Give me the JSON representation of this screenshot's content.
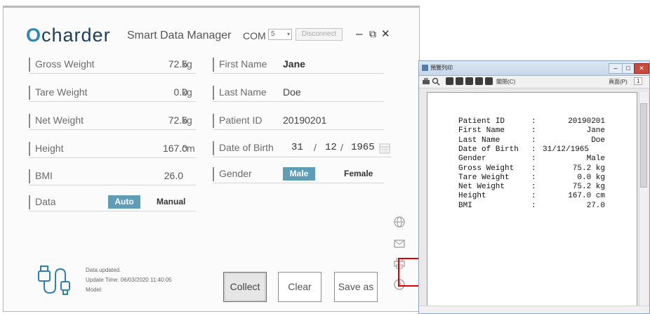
{
  "app": {
    "logo_mark": "O",
    "logo_text": "charder",
    "subtitle": "Smart Data Manager",
    "com_label": "COM",
    "com_value": "5",
    "disconnect_label": "Disconnect",
    "window_controls": {
      "minimize": "–",
      "restore": "⧉",
      "close": "✕"
    }
  },
  "measurements": [
    {
      "label": "Gross Weight",
      "value": "72.5",
      "unit": "kg"
    },
    {
      "label": "Tare Weight",
      "value": "0.0",
      "unit": "kg"
    },
    {
      "label": "Net Weight",
      "value": "72.5",
      "unit": "kg"
    },
    {
      "label": "Height",
      "value": "167.0",
      "unit": "cm"
    },
    {
      "label": "BMI",
      "value": "26.0",
      "unit": ""
    }
  ],
  "data_mode": {
    "label": "Data",
    "options": [
      "Auto",
      "Manual"
    ],
    "selected": "Auto"
  },
  "patient": {
    "first_name_label": "First Name",
    "first_name": "Jane",
    "last_name_label": "Last Name",
    "last_name": "Doe",
    "id_label": "Patient ID",
    "id": "20190201",
    "dob_label": "Date of Birth",
    "dob_day": "31",
    "dob_month": "12",
    "dob_year": "1965",
    "dob_sep": "/",
    "gender_label": "Gender",
    "gender_options": [
      "Male",
      "Female"
    ],
    "gender_selected": "Male"
  },
  "status": {
    "line1": "Data updated.",
    "line2": "Update Time: 06/03/2020 11:40:05",
    "line3": "Model:"
  },
  "buttons": {
    "collect": "Collect",
    "clear": "Clear",
    "save_as": "Save as"
  },
  "side_icons": [
    "globe-icon",
    "mail-icon",
    "printer-icon",
    "help-icon"
  ],
  "print_preview": {
    "title": "預覽列印",
    "toolbar_text": "關閉(C)",
    "page_label": "頁面(P)",
    "page_number": "1",
    "lines": [
      {
        "key": "Patient ID",
        "value": "20190201"
      },
      {
        "key": "First Name",
        "value": "Jane"
      },
      {
        "key": "Last Name",
        "value": "Doe"
      },
      {
        "key": "Date of Birth",
        "value": "31/12/1965",
        "left": true
      },
      {
        "key": "Gender",
        "value": "Male"
      },
      {
        "key": "Gross Weight",
        "value": "75.2 kg"
      },
      {
        "key": "Tare Weight",
        "value": "0.0 kg"
      },
      {
        "key": "Net Weight",
        "value": "75.2 kg"
      },
      {
        "key": "Height",
        "value": "167.0 cm"
      },
      {
        "key": "BMI",
        "value": "27.0"
      }
    ],
    "colon": ":"
  },
  "colors": {
    "accent": "#5f9db7",
    "highlight": "#e00000",
    "logo": "#1f3d5a"
  }
}
